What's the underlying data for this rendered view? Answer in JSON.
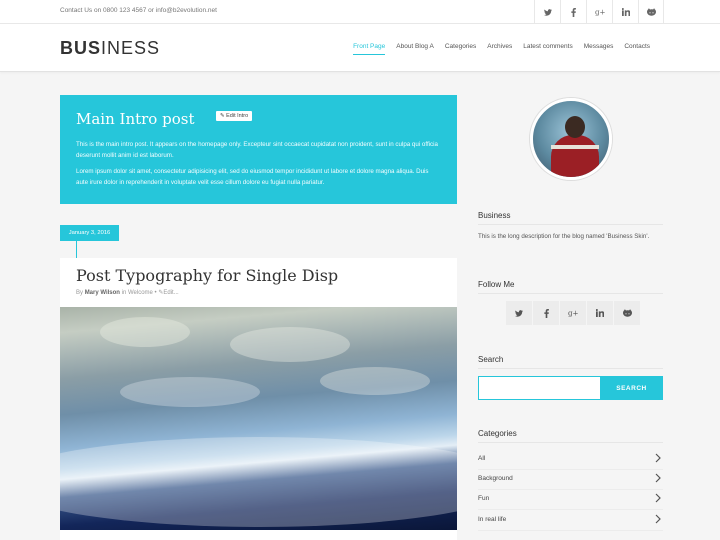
{
  "topbar": {
    "contact": "Contact Us on 0800 123 4567 or info@b2evolution.net",
    "social": [
      "twitter-icon",
      "facebook-icon",
      "google-plus-icon",
      "linkedin-icon",
      "github-icon"
    ]
  },
  "header": {
    "logo_bold": "BUS",
    "logo_light": "INESS",
    "nav": [
      "Front Page",
      "About Blog A",
      "Categories",
      "Archives",
      "Latest comments",
      "Messages",
      "Contacts"
    ],
    "active_nav": "Front Page"
  },
  "intro": {
    "title": "Main Intro post",
    "edit_label": "Edit Intro",
    "para1": "This is the main intro post. It appears on the homepage only. Excepteur sint occaecat cupidatat non proident, sunt in culpa qui officia deserunt mollit anim id est laborum.",
    "para2": "Lorem ipsum dolor sit amet, consectetur adipisicing elit, sed do eiusmod tempor incididunt ut labore et dolore magna aliqua. Duis aute irure dolor in reprehenderit in voluptate velit esse cillum dolore eu fugiat nulla pariatur."
  },
  "post": {
    "date": "January 3, 2016",
    "title": "Post Typography for Single Disp",
    "meta_by": "By",
    "author": "Mary Wilson",
    "meta_in": "in Welcome •",
    "edit_label": "Edit..."
  },
  "sidebar": {
    "blog_title": "Business",
    "blog_desc": "This is the long description for the blog named 'Business Skin'.",
    "follow_title": "Follow Me",
    "follow_social": [
      "twitter-icon",
      "facebook-icon",
      "google-plus-icon",
      "linkedin-icon",
      "github-icon"
    ],
    "search_title": "Search",
    "search_placeholder": "",
    "search_button": "SEARCH",
    "categories_title": "Categories",
    "categories": [
      "All",
      "Background",
      "Fun",
      "In real life"
    ]
  },
  "colors": {
    "accent": "#26c6da"
  }
}
